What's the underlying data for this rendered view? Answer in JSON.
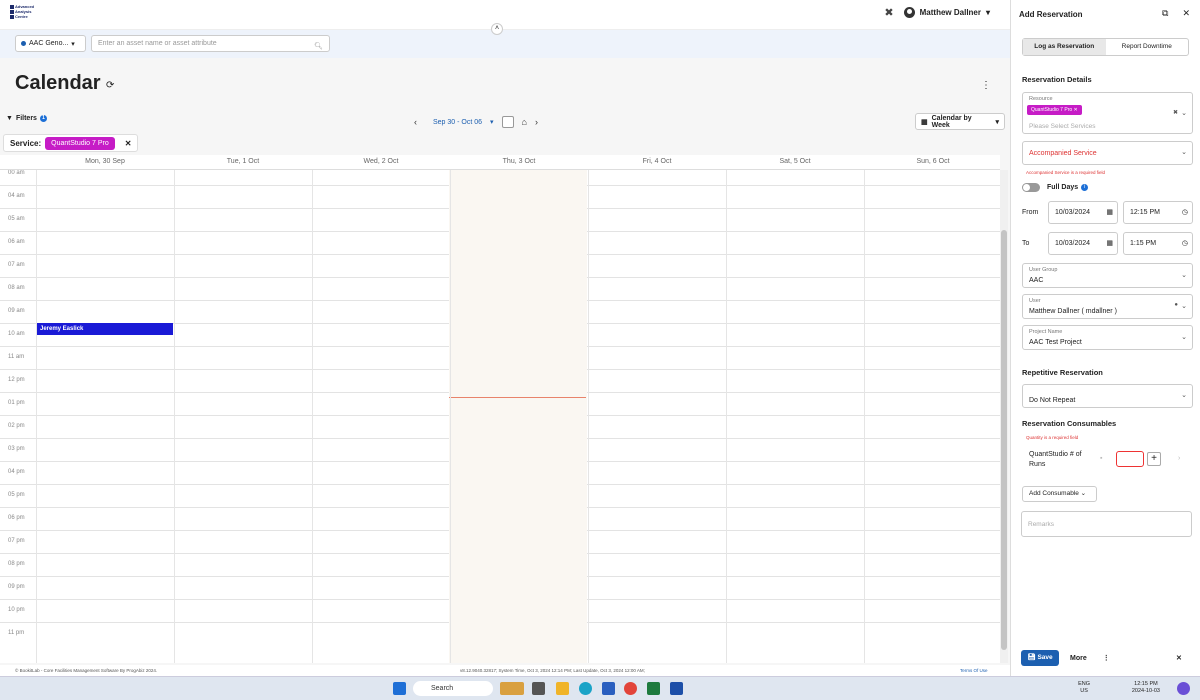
{
  "logo": {
    "lines": [
      "Advanced",
      "Analysis",
      "Centre"
    ]
  },
  "header": {
    "user_name": "Matthew Dallner",
    "chevron": "▾"
  },
  "search": {
    "scope_label": "AAC Geno...",
    "placeholder": "Enter an asset name or asset attribute"
  },
  "page": {
    "title": "Calendar"
  },
  "filters": {
    "label": "Filters",
    "count": "1",
    "service_label": "Service:",
    "service_value": "QuantStudio 7 Pro"
  },
  "nav": {
    "range": "Sep 30 - Oct 06",
    "view": "Calendar by Week"
  },
  "days": [
    "Mon, 30 Sep",
    "Tue, 1 Oct",
    "Wed, 2 Oct",
    "Thu, 3 Oct",
    "Fri, 4 Oct",
    "Sat, 5 Oct",
    "Sun, 6 Oct"
  ],
  "hours": [
    "00 am",
    "04 am",
    "05 am",
    "06 am",
    "07 am",
    "08 am",
    "09 am",
    "10 am",
    "11 am",
    "12 pm",
    "01 pm",
    "02 pm",
    "03 pm",
    "04 pm",
    "05 pm",
    "06 pm",
    "07 pm",
    "08 pm",
    "09 pm",
    "10 pm",
    "11 pm"
  ],
  "event": {
    "title": "Jeremy Easlick"
  },
  "footer": {
    "left": "© BookitLab - Core Facilities Management Software By ProgAbiz 2024.",
    "center": "v8.12.9040.32817; System Time, Oct 3, 2024 12:14 PM; Last Update, Oct 3, 2024 12:00 AM;",
    "right": "Terms Of Use"
  },
  "panel": {
    "title": "Add Reservation",
    "tab_reservation": "Log as Reservation",
    "tab_downtime": "Report Downtime",
    "details_heading": "Reservation Details",
    "resource_label": "Resource",
    "resource_chip": "QuantStudio 7 Pro",
    "services_placeholder": "Please Select Services",
    "accompanied_label": "Accompanied Service",
    "accompanied_error": "Accompanied Service is a required field",
    "full_days_label": "Full Days",
    "from_label": "From",
    "from_date": "10/03/2024",
    "from_time": "12:15 PM",
    "to_label": "To",
    "to_date": "10/03/2024",
    "to_time": "1:15 PM",
    "user_group_label": "User Group",
    "user_group_value": "AAC",
    "user_label": "User",
    "user_value": "Matthew Dallner ( mdallner )",
    "project_label": "Project Name",
    "project_value": "AAC Test Project",
    "repetitive_heading": "Repetitive Reservation",
    "repeat_value": "Do Not Repeat",
    "consumables_heading": "Reservation Consumables",
    "quantity_error": "Quantity is a required field",
    "consumable_name": "QuantStudio # of Runs",
    "add_consumable": "Add Consumable",
    "remarks_placeholder": "Remarks",
    "save_label": "Save",
    "more_label": "More"
  },
  "taskbar": {
    "search": "Search",
    "lang": "ENG",
    "region": "US",
    "time": "12:15 PM",
    "date": "2024-10-03"
  }
}
